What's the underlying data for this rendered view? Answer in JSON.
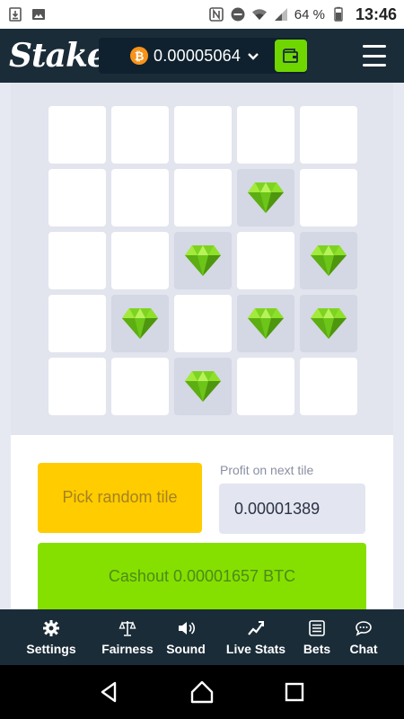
{
  "status_bar": {
    "battery": "64 %",
    "time": "13:46",
    "icons": [
      "download-icon",
      "image-icon",
      "nfc-icon",
      "do-not-disturb-icon",
      "wifi-icon",
      "signal-icon",
      "battery-icon"
    ]
  },
  "header": {
    "logo": "Stake",
    "currency_icon": "bitcoin-icon",
    "balance": "0.00005064",
    "wallet_icon": "wallet-icon",
    "menu_icon": "hamburger-icon"
  },
  "game": {
    "tiles": [
      [
        "hidden",
        "hidden",
        "hidden",
        "hidden",
        "hidden"
      ],
      [
        "hidden",
        "hidden",
        "hidden",
        "gem",
        "hidden"
      ],
      [
        "hidden",
        "hidden",
        "gem",
        "hidden",
        "gem"
      ],
      [
        "hidden",
        "gem",
        "hidden",
        "gem",
        "gem"
      ],
      [
        "hidden",
        "hidden",
        "gem",
        "hidden",
        "hidden"
      ]
    ],
    "gem_color": "#7ed321"
  },
  "controls": {
    "pick_random_label": "Pick random tile",
    "profit_label": "Profit on next tile",
    "profit_value": "0.00001389",
    "cashout_label": "Cashout 0.00001657 BTC"
  },
  "bottom_nav": [
    {
      "label": "Settings",
      "icon": "gear-icon"
    },
    {
      "label": "Fairness",
      "icon": "scale-icon"
    },
    {
      "label": "Sound",
      "icon": "speaker-icon"
    },
    {
      "label": "Live Stats",
      "icon": "chart-icon"
    },
    {
      "label": "Bets",
      "icon": "list-icon"
    },
    {
      "label": "Chat",
      "icon": "chat-icon"
    }
  ],
  "colors": {
    "header_bg": "#1a2c38",
    "accent_green": "#85e000",
    "accent_yellow": "#ffcc00",
    "bitcoin": "#f7931a"
  }
}
